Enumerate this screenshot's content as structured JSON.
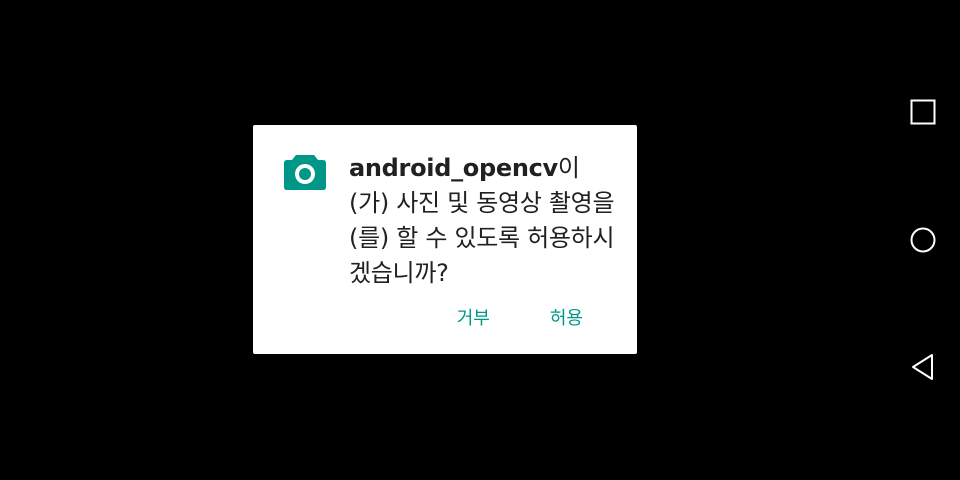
{
  "dialog": {
    "icon": "camera-icon",
    "app_name": "android_opencv",
    "message_rest": "이(가) 사진 및 동영상 촬영을(를) 할 수 있도록 허용하시겠습니까?",
    "deny_label": "거부",
    "allow_label": "허용",
    "accent_color": "#009688"
  },
  "nav_bar": {
    "items": [
      {
        "icon": "recent-apps-icon"
      },
      {
        "icon": "home-icon"
      },
      {
        "icon": "back-icon"
      }
    ]
  }
}
